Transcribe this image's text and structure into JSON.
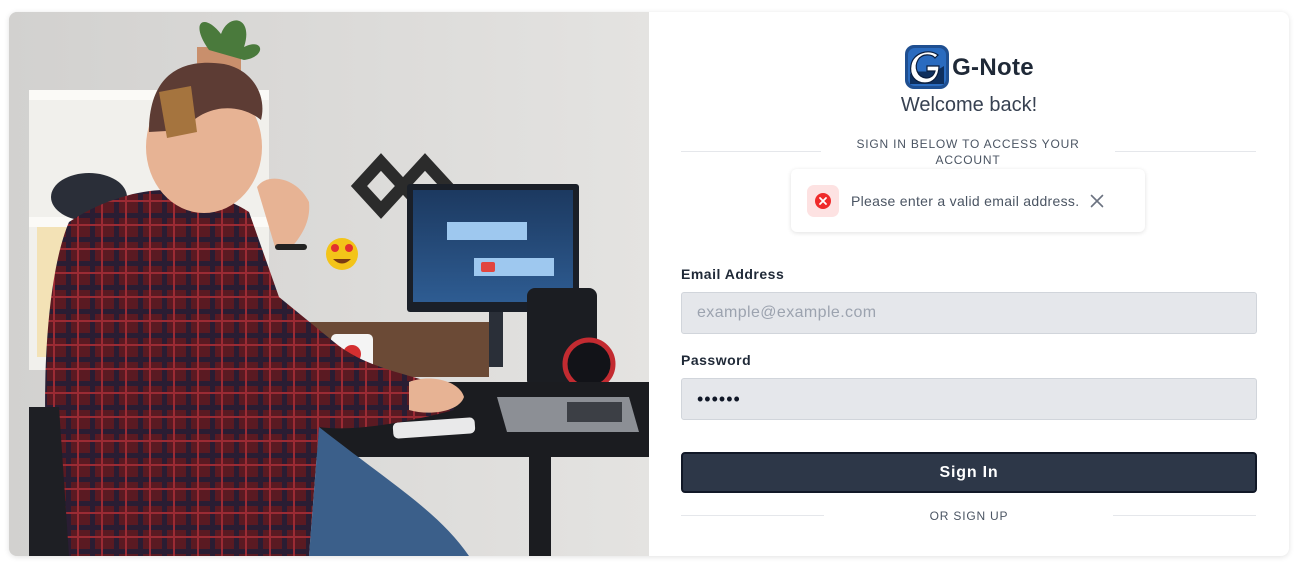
{
  "brand": {
    "name": "G-Note",
    "logo_letter": "G"
  },
  "welcome": "Welcome back!",
  "signin_divider": "SIGN IN BELOW TO ACCESS YOUR ACCOUNT",
  "toast": {
    "message": "Please enter a valid email address."
  },
  "email": {
    "label": "Email Address",
    "placeholder": "example@example.com",
    "value": ""
  },
  "password": {
    "label": "Password",
    "value": "••••••"
  },
  "signin_button": "Sign In",
  "signup_divider": "OR SIGN UP",
  "colors": {
    "button": "#2d3748",
    "input_bg": "#e5e7eb",
    "error": "#ef2b2b",
    "error_bg": "#fde2e2"
  }
}
